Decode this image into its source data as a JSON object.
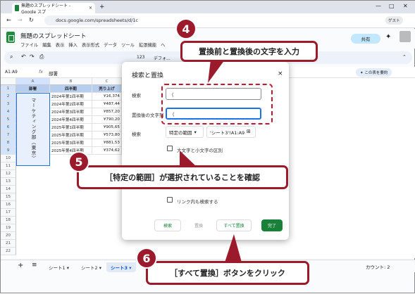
{
  "browser": {
    "tab_title": "無題のスプレッドシート - Google スプ",
    "url": "docs.google.com/spreadsheets/d/1c",
    "profile_label": "ゲスト"
  },
  "app": {
    "doc_title": "無題のスプレッドシート",
    "menus": [
      "ファイル",
      "編集",
      "表示",
      "挿入",
      "表示形式",
      "データ",
      "ツール",
      "拡張機能",
      "ヘ"
    ],
    "share_label": "共有",
    "toolbar_zoom": "123",
    "toolbar_font": "デフォ..."
  },
  "formula_bar": {
    "name_box": "A1:A9",
    "fx": "fx",
    "content": "部署",
    "summarize_label": "この表を要約"
  },
  "grid": {
    "columns": [
      "A",
      "B",
      "C"
    ],
    "rows": [
      "1",
      "2",
      "3",
      "4",
      "5",
      "6",
      "7",
      "8",
      "9",
      "10",
      "11",
      "12",
      "13",
      "14",
      "15",
      "16",
      "17",
      "18",
      "19",
      "20",
      "21",
      "22"
    ],
    "headers": [
      "部署",
      "四半期",
      "売り上げ"
    ],
    "merged_label": "マーケティング部（東京）",
    "data": [
      [
        "2024年第1四半期",
        "¥16,374"
      ],
      [
        "2024年第2四半期",
        "¥487,44"
      ],
      [
        "2024年第3四半期",
        "¥857,20"
      ],
      [
        "2024年第4四半期",
        "¥790,20"
      ],
      [
        "2025年第1四半期",
        "¥905,65"
      ],
      [
        "2025年第2四半期",
        "¥573,80"
      ],
      [
        "2025年第3四半期",
        "¥881,53"
      ],
      [
        "2025年第4四半期",
        "¥374,62"
      ]
    ]
  },
  "sheets": {
    "add": "+",
    "all": "≡",
    "tabs": [
      "シート1",
      "シート2",
      "シート3"
    ],
    "active_index": 2,
    "count_label": "カウント: 2"
  },
  "dialog": {
    "title": "検索と置換",
    "find_label": "検索",
    "find_value": "（",
    "replace_label": "置換後の文字列",
    "replace_value": "（",
    "search_label": "検索",
    "range_option": "特定の範囲",
    "range_value": "'シート3'!A1:A9",
    "case_label": "大文字と小文字の区別",
    "link_label": "リンク内も検索する",
    "buttons": {
      "find": "検索",
      "replace": "置換",
      "replace_all": "すべて置換",
      "done": "完了"
    }
  },
  "annotations": {
    "step4_num": "4",
    "step4_text": "置換前と置換後の文字を入力",
    "step5_num": "5",
    "step5_text": "［特定の範囲］が選択されていることを確認",
    "step6_num": "6",
    "step6_text": "［すべて置換］ボタンをクリック"
  },
  "colors": {
    "accent": "#9b1b2c",
    "sheets_green": "#188038",
    "header_fill": "#b7cef0"
  }
}
